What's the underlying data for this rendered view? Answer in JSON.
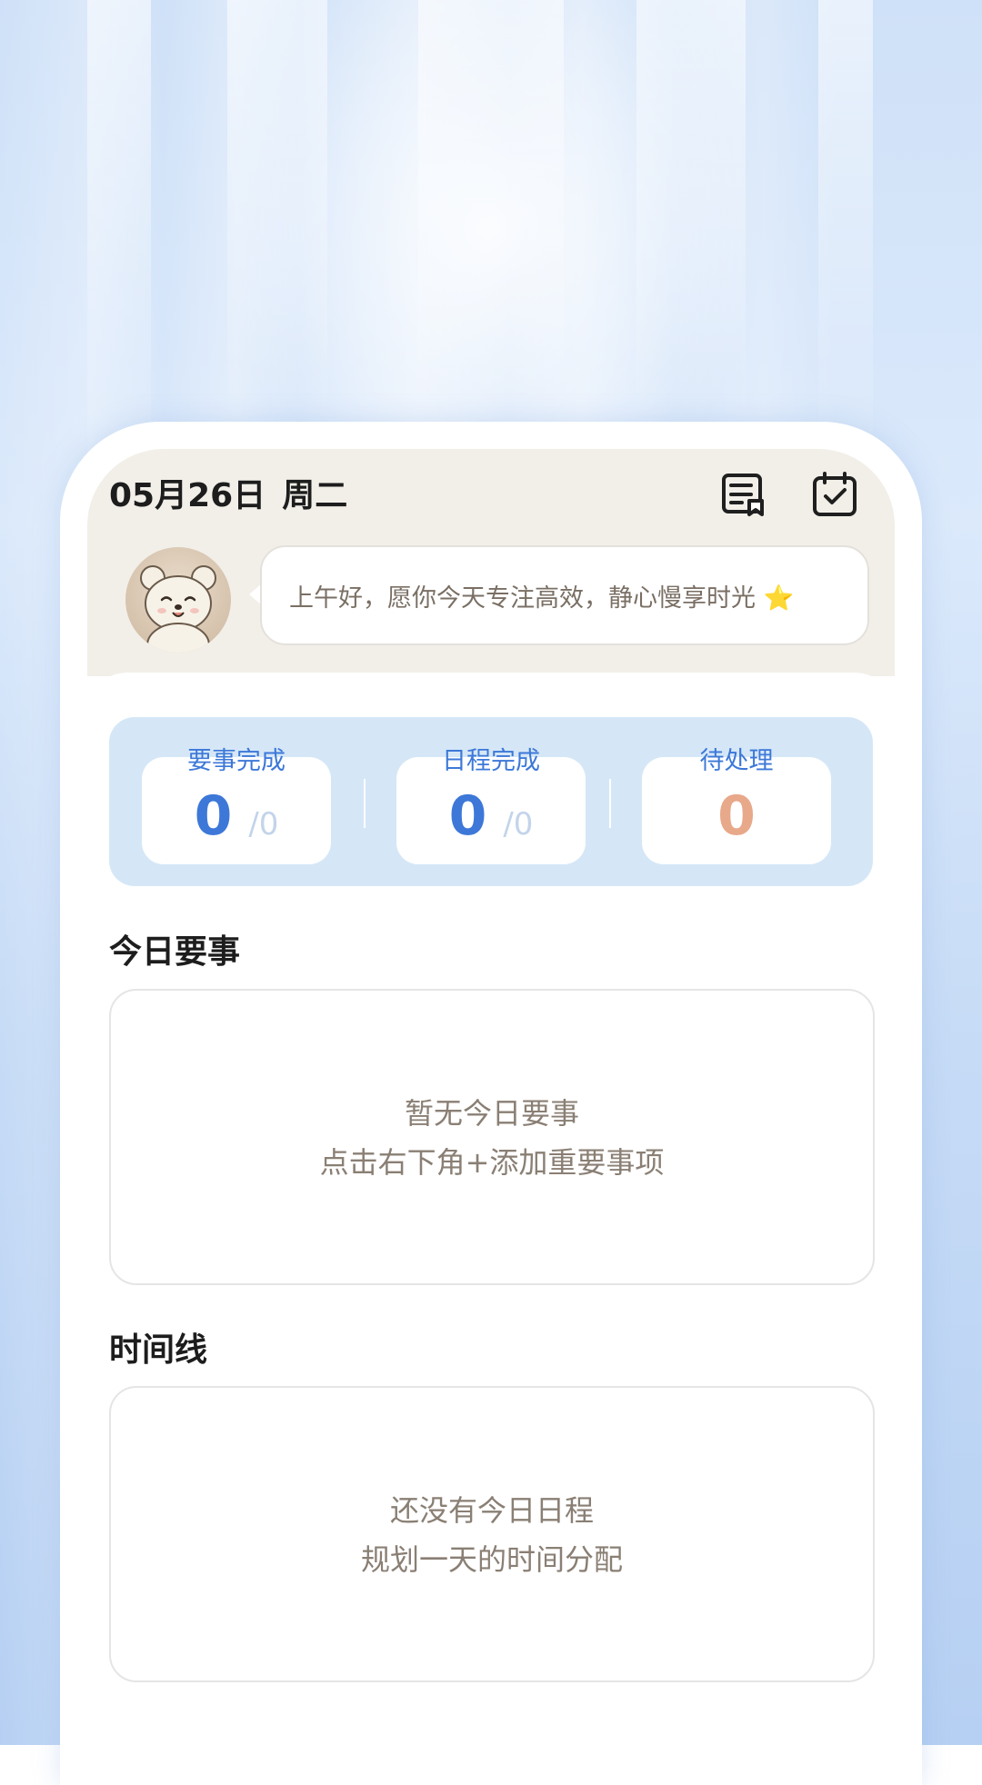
{
  "header": {
    "date": "05月26日",
    "weekday": "周二",
    "greeting": "上午好，愿你今天专注高效，静心慢享时光 ⭐"
  },
  "stats": [
    {
      "label": "要事完成",
      "value": "0",
      "total": "/0",
      "color": "#3d78d8"
    },
    {
      "label": "日程完成",
      "value": "0",
      "total": "/0",
      "color": "#3d78d8"
    },
    {
      "label": "待处理",
      "value": "0",
      "color": "#e8a88a"
    }
  ],
  "important": {
    "title": "今日要事",
    "empty_line1": "暂无今日要事",
    "empty_line2": "点击右下角+添加重要事项"
  },
  "timeline": {
    "title": "时间线",
    "empty_line1": "还没有今日日程",
    "empty_line2": "规划一天的时间分配"
  },
  "icons": [
    "note-icon",
    "calendar-check-icon",
    "bear-avatar"
  ]
}
